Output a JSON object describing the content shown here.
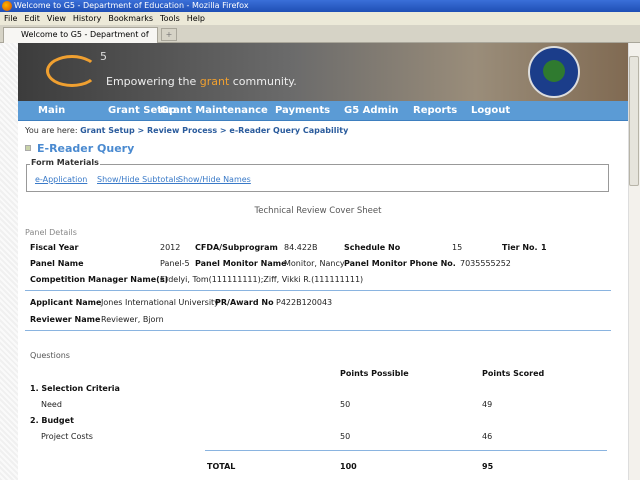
{
  "window": {
    "title": "Welcome to G5 - Department of Education - Mozilla Firefox"
  },
  "menu": [
    "File",
    "Edit",
    "View",
    "History",
    "Bookmarks",
    "Tools",
    "Help"
  ],
  "tab": {
    "label": "Welcome to G5 - Department of Edu...",
    "new_tab": "+"
  },
  "banner": {
    "logo": "G5",
    "tag_pre": "Empowering the ",
    "tag_accent": "grant",
    "tag_post": " community."
  },
  "nav": [
    "Main",
    "Grant Setup",
    "Grant Maintenance",
    "Payments",
    "G5 Admin",
    "Reports",
    "Logout"
  ],
  "breadcrumb": {
    "prefix": "You are here: ",
    "path": "Grant Setup > Review Process > e-Reader Query Capability"
  },
  "heading": "E-Reader Query",
  "form_materials": {
    "legend": "Form Materials",
    "links": [
      "e-Application",
      "Show/Hide Subtotals",
      "Show/Hide Names"
    ]
  },
  "cover_title": "Technical Review Cover Sheet",
  "panel_details": {
    "title": "Panel Details",
    "fiscal_year_label": "Fiscal Year",
    "fiscal_year": "2012",
    "cfda_label": "CFDA/Subprogram",
    "cfda": "84.422B",
    "schedule_label": "Schedule No",
    "schedule": "15",
    "tier_label": "Tier No.",
    "tier": "1",
    "panel_name_label": "Panel Name",
    "panel_name": "Panel-5",
    "monitor_label": "Panel Monitor Name",
    "monitor": "Monitor, Nancy",
    "phone_label": "Panel Monitor Phone No.",
    "phone": "7035555252",
    "cm_label": "Competition Manager Name(s)",
    "cm": "Erdelyi, Tom(111111111);Ziff, Vikki R.(111111111)"
  },
  "applicant": {
    "name_label": "Applicant Name",
    "name": "Jones International University",
    "award_label": "PR/Award No",
    "award": "P422B120043",
    "reviewer_label": "Reviewer Name",
    "reviewer": "Reviewer, Bjorn"
  },
  "questions": {
    "title": "Questions",
    "col_possible": "Points Possible",
    "col_scored": "Points Scored",
    "rows": [
      {
        "label": "1. Selection Criteria",
        "bold": true,
        "possible": "",
        "scored": ""
      },
      {
        "label": "Need",
        "bold": false,
        "possible": "50",
        "scored": "49"
      },
      {
        "label": "2. Budget",
        "bold": true,
        "possible": "",
        "scored": ""
      },
      {
        "label": "Project Costs",
        "bold": false,
        "possible": "50",
        "scored": "46"
      }
    ],
    "total_label": "TOTAL",
    "total_possible": "100",
    "total_scored": "95"
  }
}
